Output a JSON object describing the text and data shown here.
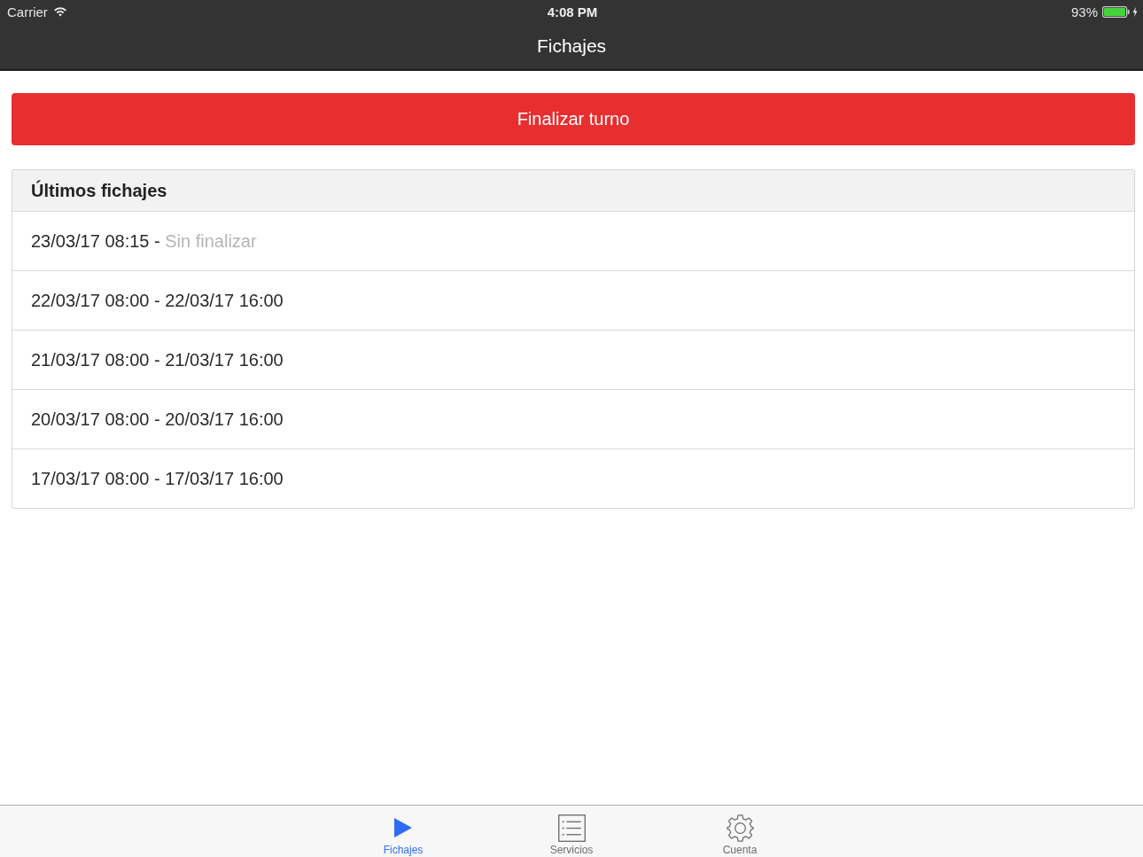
{
  "status_bar": {
    "carrier": "Carrier",
    "time": "4:08 PM",
    "battery": "93%"
  },
  "nav_bar": {
    "title": "Fichajes"
  },
  "action_button": {
    "label": "Finalizar turno"
  },
  "recent": {
    "title": "Últimos fichajes",
    "rows": [
      {
        "start": "23/03/17 08:15",
        "dash": "-",
        "end": "Sin finalizar",
        "finished": false
      },
      {
        "start": "22/03/17 08:00",
        "dash": "-",
        "end": "22/03/17 16:00",
        "finished": true
      },
      {
        "start": "21/03/17 08:00",
        "dash": "-",
        "end": "21/03/17 16:00",
        "finished": true
      },
      {
        "start": "20/03/17 08:00",
        "dash": "-",
        "end": "20/03/17 16:00",
        "finished": true
      },
      {
        "start": "17/03/17 08:00",
        "dash": "-",
        "end": "17/03/17 16:00",
        "finished": true
      }
    ]
  },
  "tab_bar": {
    "tabs": [
      {
        "label": "Fichajes",
        "kind": "play",
        "selected": true
      },
      {
        "label": "Servicios",
        "kind": "list",
        "selected": false
      },
      {
        "label": "Cuenta",
        "kind": "gear",
        "selected": false
      }
    ]
  }
}
